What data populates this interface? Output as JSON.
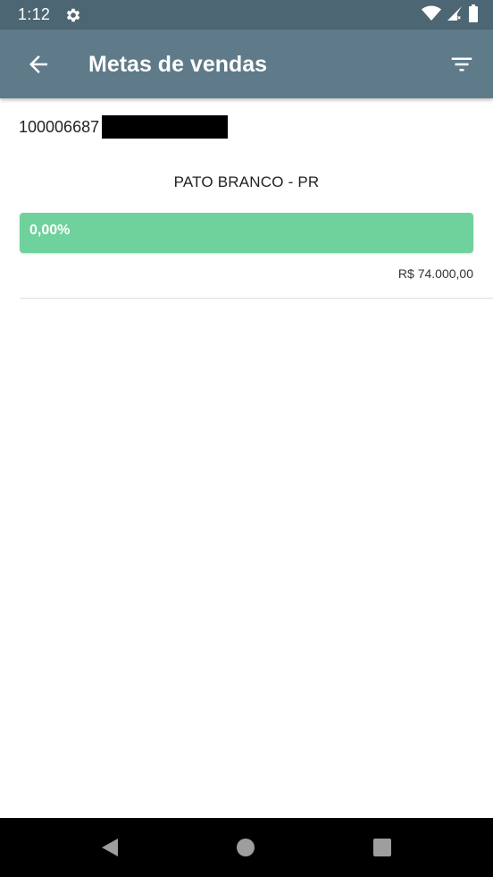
{
  "status_bar": {
    "time": "1:12",
    "icons": [
      "gear-icon",
      "wifi-icon",
      "signal-icon",
      "battery-icon"
    ]
  },
  "app_bar": {
    "title": "Metas de vendas",
    "back_icon": "arrow-left-icon",
    "filter_icon": "filter-icon"
  },
  "goal": {
    "code": "100006687",
    "city": "PATO BRANCO - PR",
    "progress_label": "0,00%",
    "progress_value": 0,
    "target": "R$ 74.000,00"
  },
  "colors": {
    "status_bar": "#4d6674",
    "app_bar": "#5f7b89",
    "progress": "#6fd29c"
  },
  "nav_bar": {
    "icons": [
      "back-triangle-icon",
      "home-circle-icon",
      "recents-square-icon"
    ]
  }
}
